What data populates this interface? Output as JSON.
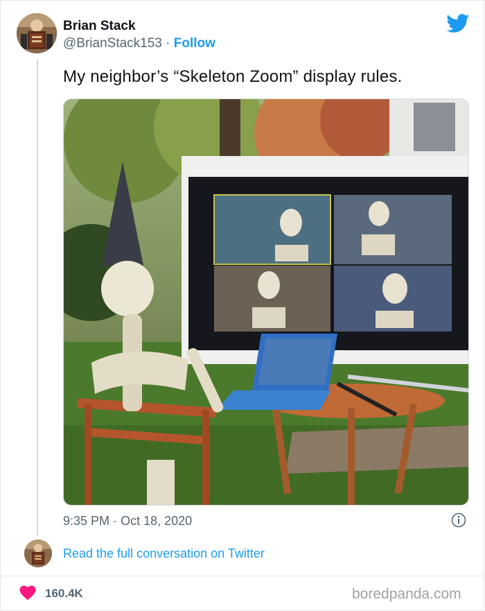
{
  "author": {
    "name": "Brian Stack",
    "handle": "@BrianStack153",
    "separator": "·",
    "follow_label": "Follow"
  },
  "tweet": {
    "text": "My neighbor’s “Skeleton Zoom” display rules.",
    "time": "9:35 PM",
    "date_separator": "·",
    "date": "Oct 18, 2020"
  },
  "footer": {
    "read_link": "Read the full conversation on Twitter",
    "likes": "160.4K",
    "brand": "boredpanda.com"
  },
  "icons": {
    "logo": "twitter-bird-icon",
    "info": "info-icon",
    "like": "heart-icon"
  },
  "colors": {
    "accent": "#1d9bf0",
    "heart": "#f91880",
    "muted_text": "#536471",
    "brand_text": "#9aa3aa"
  }
}
